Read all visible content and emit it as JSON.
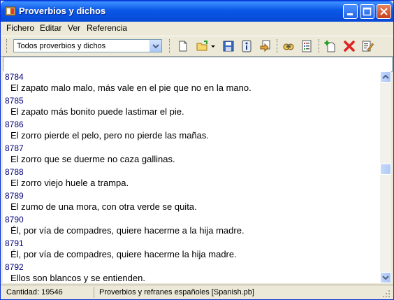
{
  "window": {
    "title": "Proverbios y dichos"
  },
  "menu": [
    "Fichero",
    "Editar",
    "Ver",
    "Referencia"
  ],
  "toolbar": {
    "combo_value": "Todos proverbios y dichos",
    "icons": [
      "new-icon",
      "open-icon",
      "dropdown-arrow-icon",
      "save-icon",
      "info-icon",
      "export-icon",
      "find-icon",
      "list-icon",
      "add-icon",
      "delete-icon",
      "edit-icon"
    ]
  },
  "entries": [
    {
      "num": "8784",
      "text": "El zapato malo malo, más vale en el pie que no en la mano."
    },
    {
      "num": "8785",
      "text": "El zapato más bonito puede lastimar el pie."
    },
    {
      "num": "8786",
      "text": "El zorro pierde el pelo, pero no pierde las mañas."
    },
    {
      "num": "8787",
      "text": "El zorro que se duerme no caza gallinas."
    },
    {
      "num": "8788",
      "text": "El zorro viejo huele a trampa."
    },
    {
      "num": "8789",
      "text": "El zumo de una mora, con otra verde se quita."
    },
    {
      "num": "8790",
      "text": "Él, por vía de compadres, quiere hacerme a la hija madre."
    },
    {
      "num": "8791",
      "text": "Él, por vía de compadres, quiere hacerme la hija madre."
    },
    {
      "num": "8792",
      "text": "Ellos son blancos y se entienden."
    }
  ],
  "status": {
    "count": "Cantidad: 19546",
    "source": "Proverbios y refranes españoles [Spanish.pb]"
  }
}
